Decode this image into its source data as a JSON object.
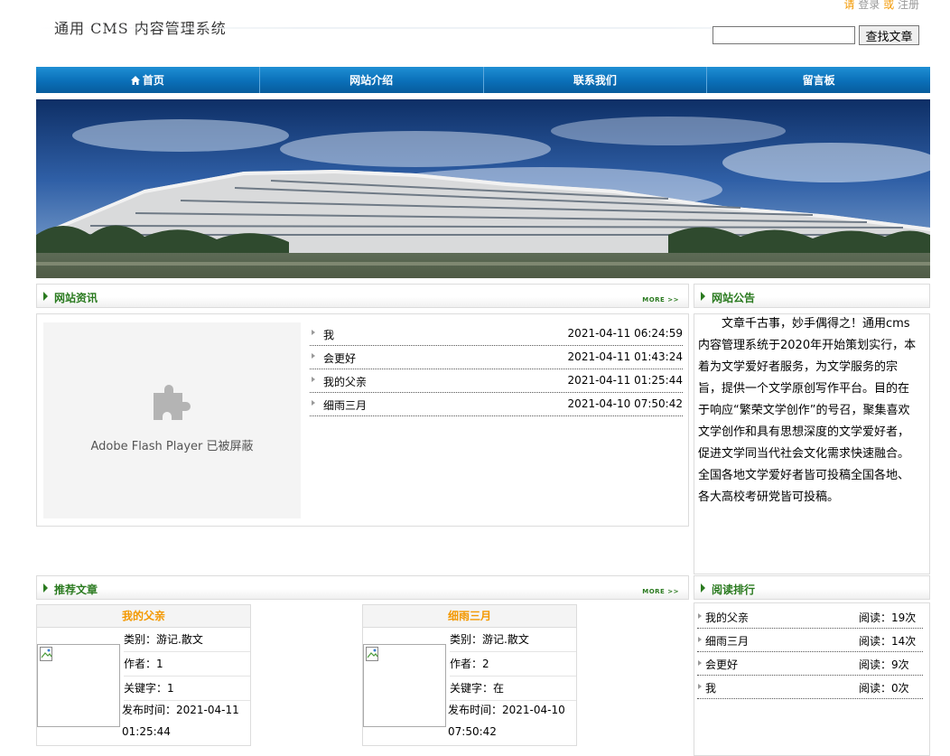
{
  "header": {
    "title": "通用 CMS 内容管理系统",
    "login_prefix": "请",
    "login_label": "登录",
    "login_or": "或",
    "register_label": "注册",
    "search": {
      "value": "",
      "placeholder": ""
    },
    "search_button": "查找文章"
  },
  "nav": {
    "items": [
      {
        "label": "首页",
        "icon": "home-icon"
      },
      {
        "label": "网站介绍"
      },
      {
        "label": "联系我们"
      },
      {
        "label": "留言板"
      }
    ]
  },
  "news": {
    "title": "网站资讯",
    "more": "MORE >>",
    "flash_label": "Adobe Flash Player 已被屏蔽",
    "items": [
      {
        "title": "我",
        "date": "2021-04-11 06:24:59"
      },
      {
        "title": "会更好",
        "date": "2021-04-11 01:43:24"
      },
      {
        "title": "我的父亲",
        "date": "2021-04-11 01:25:44"
      },
      {
        "title": "细雨三月",
        "date": "2021-04-10 07:50:42"
      }
    ]
  },
  "notice": {
    "title": "网站公告",
    "text": "文章千古事，妙手偶得之！通用cms内容管理系统于2020年开始策划实行，本着为文学爱好者服务，为文学服务的宗旨，提供一个文学原创写作平台。目的在于响应“繁荣文学创作”的号召，聚集喜欢文学创作和具有思想深度的文学爱好者，促进文学同当代社会文化需求快速融合。全国各地文学爱好者皆可投稿全国各地、各大高校考研党皆可投稿。"
  },
  "recommended": {
    "title": "推荐文章",
    "more": "MORE >>",
    "items": [
      {
        "title": "我的父亲",
        "category": "类别：游记.散文",
        "author": "作者：1",
        "keyword": "关键字：1",
        "published": "发布时间：2021-04-11 01:25:44"
      },
      {
        "title": "细雨三月",
        "category": "类别：游记.散文",
        "author": "作者：2",
        "keyword": "关键字：在",
        "published": "发布时间：2021-04-10 07:50:42"
      }
    ]
  },
  "ranking": {
    "title": "阅读排行",
    "items": [
      {
        "title": "我的父亲",
        "reads": "阅读：19次"
      },
      {
        "title": "细雨三月",
        "reads": "阅读：14次"
      },
      {
        "title": "会更好",
        "reads": "阅读：9次"
      },
      {
        "title": "我",
        "reads": "阅读：0次"
      }
    ]
  },
  "colors": {
    "nav_blue": "#0a6fb8",
    "section_green": "#2a7a1f",
    "accent_orange": "#f39800"
  }
}
